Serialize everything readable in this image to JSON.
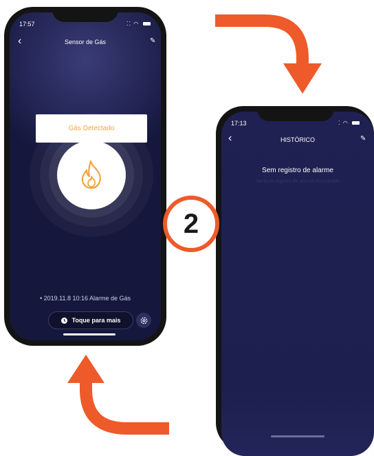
{
  "phone1": {
    "status_time": "17:57",
    "title": "Sensor de Gás",
    "tooltip": "Gás Detectado",
    "alarm_log": "2019.11.8 10:16 Alarme de Gás",
    "touch_button": "Toque para mais",
    "icons": [
      "back-arrow-icon",
      "edit-pencil-icon",
      "flame-icon",
      "clock-icon",
      "settings-gear-icon"
    ]
  },
  "phone2": {
    "status_time": "17:13",
    "title": "HISTÓRICO",
    "empty_title": "Sem registro de alarme",
    "empty_subtitle": "Nenhum registro de alarme encontrado",
    "icons": [
      "back-arrow-icon",
      "edit-pencil-icon"
    ]
  },
  "step_badge": "2",
  "colors": {
    "arrow": "#ee5a29",
    "screen_bg": "#262859",
    "tooltip_text": "#f3a53b",
    "flame": "#f3a53b"
  }
}
